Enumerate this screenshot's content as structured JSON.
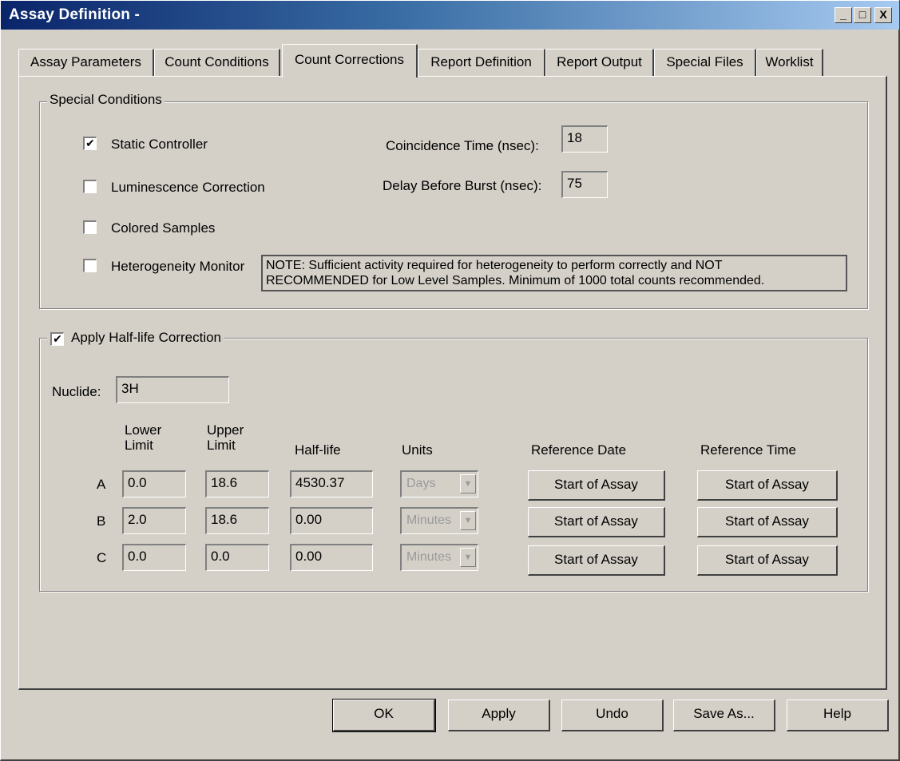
{
  "window": {
    "title": "Assay Definition -",
    "minimize_label": "_",
    "maximize_label": "□",
    "close_label": "X"
  },
  "tabs": [
    {
      "label": "Assay Parameters"
    },
    {
      "label": "Count Conditions"
    },
    {
      "label": "Count Corrections",
      "active": true
    },
    {
      "label": "Report Definition"
    },
    {
      "label": "Report Output"
    },
    {
      "label": "Special Files"
    },
    {
      "label": "Worklist"
    }
  ],
  "special_conditions": {
    "legend": "Special Conditions",
    "static_controller": {
      "label": "Static Controller",
      "checked": true
    },
    "luminescence_correction": {
      "label": "Luminescence Correction",
      "checked": false
    },
    "colored_samples": {
      "label": "Colored Samples",
      "checked": false
    },
    "heterogeneity_monitor": {
      "label": "Heterogeneity Monitor",
      "checked": false
    },
    "coincidence_time": {
      "label": "Coincidence Time (nsec):",
      "value": "18"
    },
    "delay_before_burst": {
      "label": "Delay Before Burst (nsec):",
      "value": "75"
    },
    "note_line1": "NOTE: Sufficient activity required for heterogeneity to perform correctly and NOT",
    "note_line2": "RECOMMENDED for Low Level Samples. Minimum of 1000 total counts recommended."
  },
  "half_life": {
    "legend": "Apply Half-life Correction",
    "checked": true,
    "nuclide_label": "Nuclide:",
    "nuclide_value": "3H",
    "headers": {
      "lower_1": "Lower",
      "lower_2": "Limit",
      "upper_1": "Upper",
      "upper_2": "Limit",
      "half_life": "Half-life",
      "units": "Units",
      "reference_date": "Reference Date",
      "reference_time": "Reference Time"
    },
    "rows": [
      {
        "label": "A",
        "lower": "0.0",
        "upper": "18.6",
        "half_life": "4530.37",
        "units": "Days",
        "ref_date": "Start of Assay",
        "ref_time": "Start of Assay"
      },
      {
        "label": "B",
        "lower": "2.0",
        "upper": "18.6",
        "half_life": "0.00",
        "units": "Minutes",
        "ref_date": "Start of Assay",
        "ref_time": "Start of Assay"
      },
      {
        "label": "C",
        "lower": "0.0",
        "upper": "0.0",
        "half_life": "0.00",
        "units": "Minutes",
        "ref_date": "Start of Assay",
        "ref_time": "Start of Assay"
      }
    ]
  },
  "buttons": {
    "ok": "OK",
    "apply": "Apply",
    "undo": "Undo",
    "save_as": "Save As...",
    "help": "Help"
  },
  "colors": {
    "face": "#d4d0c8",
    "title_start": "#0a246a",
    "title_end": "#a6caf0"
  },
  "icons": {
    "check": "✔",
    "dropdown": "▼"
  }
}
